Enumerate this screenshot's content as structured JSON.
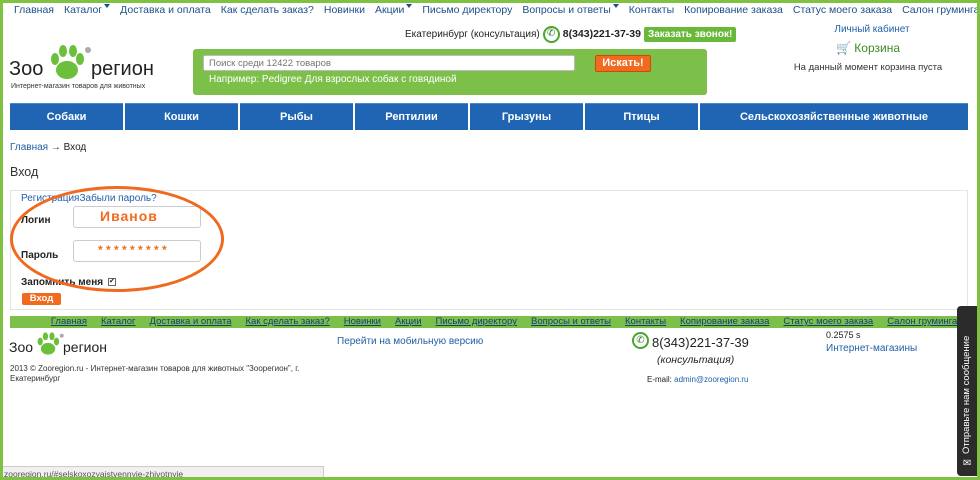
{
  "top_nav": [
    "Главная",
    "Каталог",
    "Доставка и оплата",
    "Как сделать заказ?",
    "Новинки",
    "Акции",
    "Письмо директору",
    "Вопросы и ответы",
    "Контакты",
    "Копирование заказа",
    "Статус моего заказа",
    "Салон груминга"
  ],
  "dropdown_items": [
    1,
    5,
    7
  ],
  "logo": {
    "left": "Зоо",
    "right": "регион",
    "tagline": "Интернет-магазин товаров для животных"
  },
  "header": {
    "city": "Екатеринбург (консультация)",
    "phone": "8(343)221-37-39",
    "call_button": "Заказать звонок!",
    "search_placeholder": "Поиск среди 12422 товаров",
    "search_button": "Искать!",
    "search_example": "Например: Pedigree Для взрослых собак с говядиной",
    "account_link": "Личный кабинет",
    "cart": "Корзина",
    "cart_status": "На данный момент корзина пуста"
  },
  "main_menu": [
    "Собаки",
    "Кошки",
    "Рыбы",
    "Рептилии",
    "Грызуны",
    "Птицы",
    "Сельскохозяйственные животные"
  ],
  "breadcrumb": {
    "home": "Главная",
    "sep": "→",
    "current": "Вход"
  },
  "page_title": "Вход",
  "login": {
    "register": "Регистрация",
    "forgot": "Забыли пароль?",
    "login_label": "Логин",
    "login_value": "Иванов",
    "password_label": "Пароль",
    "password_value": "* * * * * * * * *",
    "remember": "Запомнить меня",
    "remember_check": "✔",
    "submit": "Вход"
  },
  "footer": {
    "nav": [
      "Главная",
      "Каталог",
      "Доставка и оплата",
      "Как сделать заказ?",
      "Новинки",
      "Акции",
      "Письмо директору",
      "Вопросы и ответы",
      "Контакты",
      "Копирование заказа",
      "Статус моего заказа",
      "Салон груминга"
    ],
    "copyright": "2013 © Zooregion.ru - Интернет-магазин товаров для животных \"Зоорегион\", г. Екатеринбург",
    "mobile": "Перейти на мобильную версию",
    "phone": "8(343)221-37-39",
    "consult": "(консультация)",
    "email_label": "E-mail:",
    "email": "admin@zooregion.ru",
    "speed": "0.2575 s",
    "shops": "Интернет-магазины"
  },
  "feedback": "Отправьте нам сообщение",
  "status_url": "zooregion.ru/#selskoxozyajstvennyie-zhivotnyie",
  "colors": {
    "green": "#7cc04a",
    "blue": "#1f65b3",
    "orange": "#f06a1f"
  }
}
